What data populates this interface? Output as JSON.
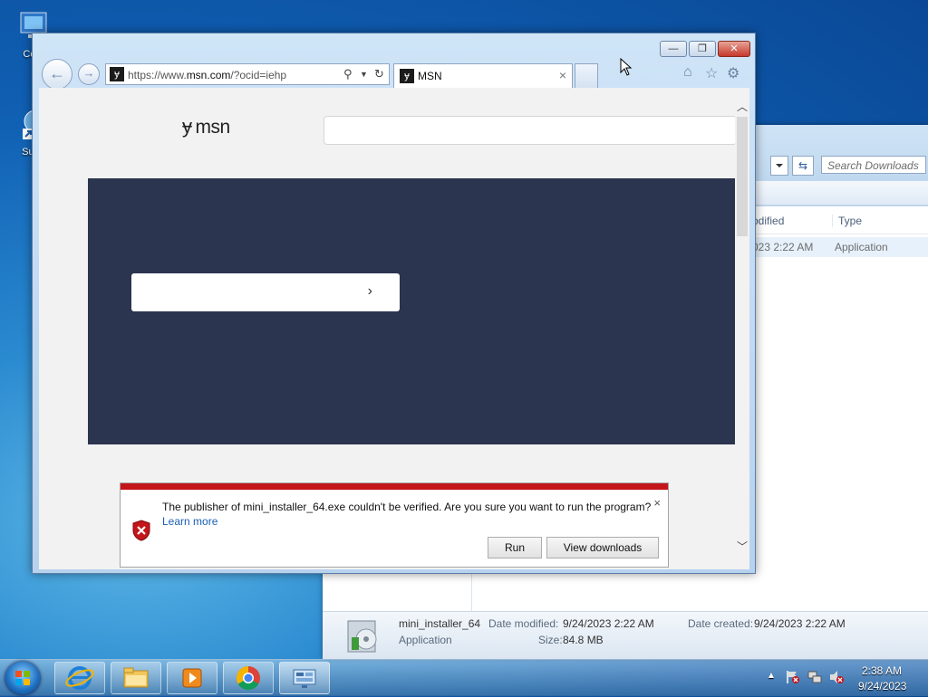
{
  "desktop": {
    "icons": [
      {
        "label": "Com",
        "icon": "computer-icon"
      },
      {
        "label": "Supe",
        "icon": "shortcut-app-icon"
      }
    ]
  },
  "explorer": {
    "search_placeholder": "Search Downloads",
    "columns": [
      "odified",
      "Type"
    ],
    "row": {
      "date": "023 2:22 AM",
      "type": "Application"
    },
    "details": {
      "name": "mini_installer_64",
      "kind": "Application",
      "date_modified_label": "Date modified:",
      "date_modified": "9/24/2023 2:22 AM",
      "date_created_label": "Date created:",
      "date_created": "9/24/2023 2:22 AM",
      "size_label": "Size:",
      "size": "84.8 MB"
    }
  },
  "browser": {
    "url_prefix": "https://www.",
    "url_domain": "msn.com",
    "url_path": "/?ocid=iehp",
    "tab_title": "MSN",
    "tab_close": "×",
    "favicon_glyph": "ɏ",
    "caption": {
      "minimize": "—",
      "maximize": "❐",
      "close": "✕"
    },
    "page": {
      "logo_text": "msn",
      "logo_mark": "ɏ",
      "hero_chevron": "›"
    }
  },
  "notification": {
    "message": "The publisher of mini_installer_64.exe couldn't be verified. Are you sure you want to run the program?",
    "link": "Learn more",
    "run_label": "Run",
    "view_downloads_label": "View downloads",
    "close": "×"
  },
  "taskbar": {
    "items": [
      {
        "name": "internet-explorer",
        "icon": "ie-icon"
      },
      {
        "name": "file-explorer",
        "icon": "folder-icon"
      },
      {
        "name": "media-player",
        "icon": "media-player-icon"
      },
      {
        "name": "chrome",
        "icon": "chrome-icon"
      },
      {
        "name": "control-panel",
        "icon": "control-panel-icon"
      }
    ],
    "clock_time": "2:38 AM",
    "clock_date": "9/24/2023"
  },
  "colors": {
    "hero_bg": "#2b354f",
    "warning_red": "#c4151b",
    "link_blue": "#1a5fb4"
  }
}
